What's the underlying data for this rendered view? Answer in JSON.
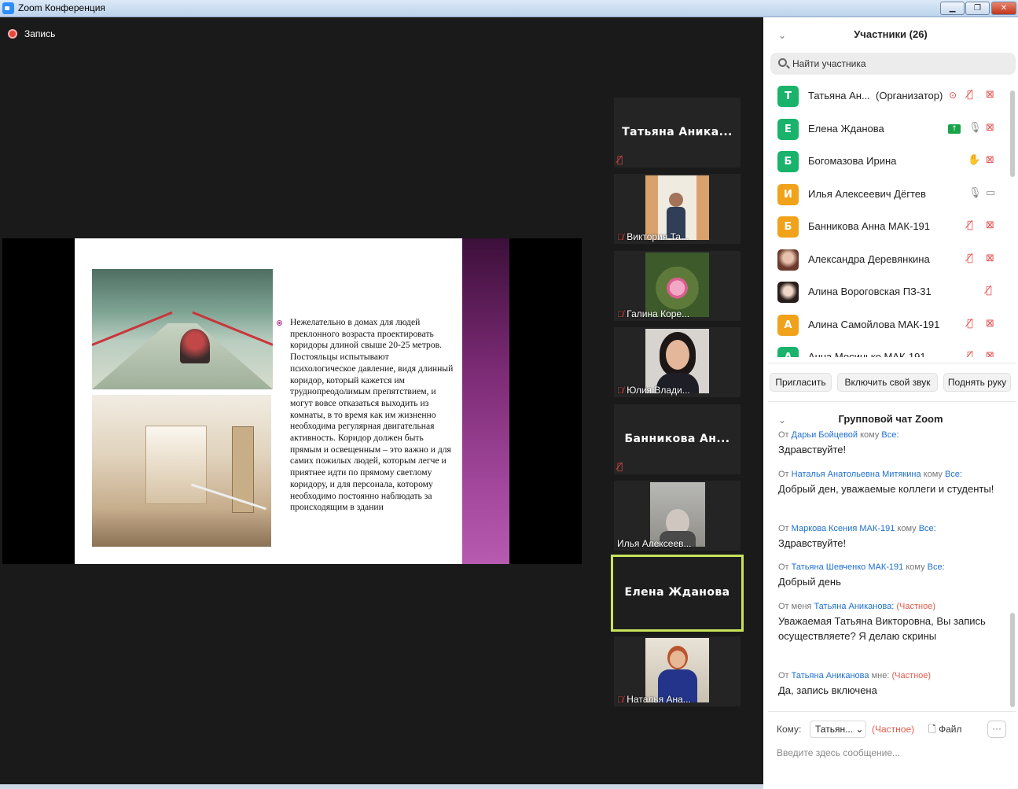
{
  "window": {
    "title": "Zoom Конференция",
    "min_label": "▁",
    "max_label": "❐",
    "close_label": "✕"
  },
  "recording": {
    "label": "Запись"
  },
  "slide": {
    "text": "Нежелательно в домах для людей преклонного возраста проектировать коридоры длиной свыше 20-25 метров. Постояльцы испытывают психологическое давление, видя длинный коридор, который кажется им труднопреодолимым препятствием, и могут вовсе отказаться выходить из комнаты, в то время как им жизненно необходима регулярная двигательная активность. Коридор должен быть прямым и освещенным – это важно и для самих пожилых людей, которым легче и приятнее идти по прямому светлому коридору, и для персонала, которому необходимо постоянно наблюдать за происходящим в здании"
  },
  "tiles": [
    {
      "name": "Татьяна Аника...",
      "type": "name"
    },
    {
      "name": "Виктория Та...",
      "type": "video"
    },
    {
      "name": "Галина Коре...",
      "type": "video"
    },
    {
      "name": "Юлия Влади...",
      "type": "video"
    },
    {
      "name": "Банникова Ан...",
      "type": "name"
    },
    {
      "name": "Илья Алексеев...",
      "type": "video"
    },
    {
      "name": "Елена Жданова",
      "type": "active"
    },
    {
      "name": "Наталья Ана...",
      "type": "video"
    }
  ],
  "participants_panel": {
    "title": "Участники (26)",
    "search_placeholder": "Найти участника",
    "items": [
      {
        "initial": "Т",
        "color": "#19b36b",
        "name": "Татьяна Ан...",
        "role": "(Организатор)"
      },
      {
        "initial": "Е",
        "color": "#19b36b",
        "name": "Елена Жданова"
      },
      {
        "initial": "Б",
        "color": "#19b36b",
        "name": "Богомазова Ирина"
      },
      {
        "initial": "И",
        "color": "#f0a21b",
        "name": "Илья Алексеевич Дёгтев"
      },
      {
        "initial": "Б",
        "color": "#f0a21b",
        "name": " Банникова Анна МАК-191"
      },
      {
        "initial": "",
        "color": "#8b5a4a",
        "name": "Александра Деревянкина"
      },
      {
        "initial": "",
        "color": "#3a2a24",
        "name": "Алина Вороговская ПЗ-31"
      },
      {
        "initial": "А",
        "color": "#f0a21b",
        "name": "Алина Самойлова МАК-191"
      },
      {
        "initial": "А",
        "color": "#19b36b",
        "name": "Анна Мосинько МАК-191"
      }
    ],
    "buttons": {
      "invite": "Пригласить",
      "unmute": "Включить свой звук",
      "raise_hand": "Поднять руку"
    }
  },
  "chat": {
    "title": "Групповой чат Zoom",
    "messages": [
      {
        "from_prefix": "От",
        "sender": "Дарьи Бойцевой",
        "to_prefix": "кому",
        "recipient": "Все:",
        "private": "",
        "text": "Здравствуйте!"
      },
      {
        "from_prefix": "От",
        "sender": "Наталья Анатольевна Митякина",
        "to_prefix": "кому",
        "recipient": "Все:",
        "private": "",
        "text": "Добрый ден, уважаемые коллеги и студенты!"
      },
      {
        "from_prefix": "От",
        "sender": "Маркова Ксения МАК-191",
        "to_prefix": "кому",
        "recipient": "Все:",
        "private": "",
        "text": "Здравствуйте!"
      },
      {
        "from_prefix": "От",
        "sender": "Татьяна Шевченко МАК-191",
        "to_prefix": "кому",
        "recipient": "Все:",
        "private": "",
        "text": "Добрый день"
      },
      {
        "from_prefix": "От меня",
        "sender": "Татьяна Аниканова:",
        "to_prefix": "",
        "recipient": "",
        "private": "(Частное)",
        "text": "Уважаемая Татьяна Викторовна, Вы запись осуществляете? Я делаю скрины"
      },
      {
        "from_prefix": "От",
        "sender": "Татьяна Аниканова",
        "to_prefix": "мне:",
        "recipient": "",
        "private": "(Частное)",
        "text": "Да, запись включена"
      }
    ],
    "to_label": "Кому:",
    "to_value": "Татьян...",
    "to_private": "(Частное)",
    "file_label": "Файл",
    "more_label": "···",
    "input_placeholder": "Введите здесь сообщение..."
  }
}
